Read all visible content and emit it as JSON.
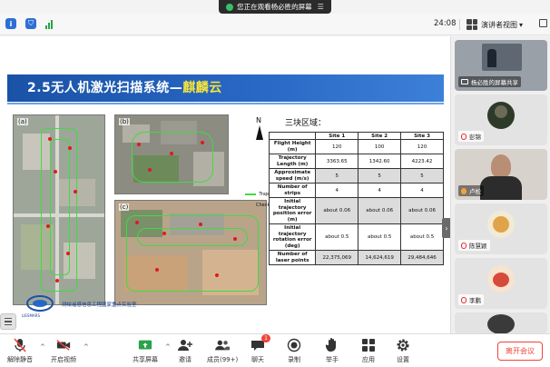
{
  "share_banner": {
    "text": "您正在观看杨必胜的屏幕"
  },
  "titlebar": {
    "timer": "24:08",
    "speaker_view_label": "演讲者视图"
  },
  "slide": {
    "title_prefix": "2.5无人机激光扫描系统—",
    "title_accent": "麒麟云",
    "map_labels": [
      "(a)",
      "(b)",
      "(c)"
    ],
    "compass_letter": "N",
    "legend": [
      "Trajectory",
      "Checkpoint"
    ],
    "table_caption": "三块区域：",
    "table": {
      "columns": [
        "",
        "Site 1",
        "Site 2",
        "Site 3"
      ],
      "rows": [
        {
          "label": "Flight Height (m)",
          "values": [
            "120",
            "100",
            "120"
          ],
          "shaded": false
        },
        {
          "label": "Trajectory Length (m)",
          "values": [
            "3363.65",
            "1342.60",
            "4223.42"
          ],
          "shaded": false
        },
        {
          "label": "Approximate speed (m/s)",
          "values": [
            "5",
            "5",
            "5"
          ],
          "shaded": true
        },
        {
          "label": "Number of strips",
          "values": [
            "4",
            "4",
            "4"
          ],
          "shaded": false
        },
        {
          "label": "Initial trajectory position error (m)",
          "values": [
            "about 0.06",
            "about 0.06",
            "about 0.06"
          ],
          "shaded": true
        },
        {
          "label": "Initial trajectory rotation error (deg)",
          "values": [
            "about 0.5",
            "about 0.5",
            "about 0.5"
          ],
          "shaded": false
        },
        {
          "label": "Number of laser points",
          "values": [
            "22,375,069",
            "14,624,619",
            "29,484,646"
          ],
          "shaded": true
        }
      ]
    },
    "logo_text": "LIESMARS",
    "footer": "测绘遥感信息工程国家重点实验室"
  },
  "participants": [
    {
      "name": "杨必胜的屏幕共享",
      "kind": "screen"
    },
    {
      "name": "彭锦",
      "kind": "muted"
    },
    {
      "name": "卢松",
      "kind": "speaking"
    },
    {
      "name": "陈慧颖",
      "kind": "muted"
    },
    {
      "name": "李鹏",
      "kind": "muted"
    },
    {
      "name": "",
      "kind": "partial"
    }
  ],
  "toolbar": {
    "mute": "解除静音",
    "video": "开启视频",
    "share": "共享屏幕",
    "invite": "邀请",
    "members": "成员(99+)",
    "chat": "聊天",
    "chat_badge": "1",
    "record": "录制",
    "raise_hand": "举手",
    "apps": "应用",
    "settings": "设置",
    "leave": "离开会议"
  },
  "colors": {
    "accent": "#2e6fd6",
    "danger": "#f0443a",
    "track": "#3fdc3f",
    "checkpoint": "#e01a1a"
  }
}
